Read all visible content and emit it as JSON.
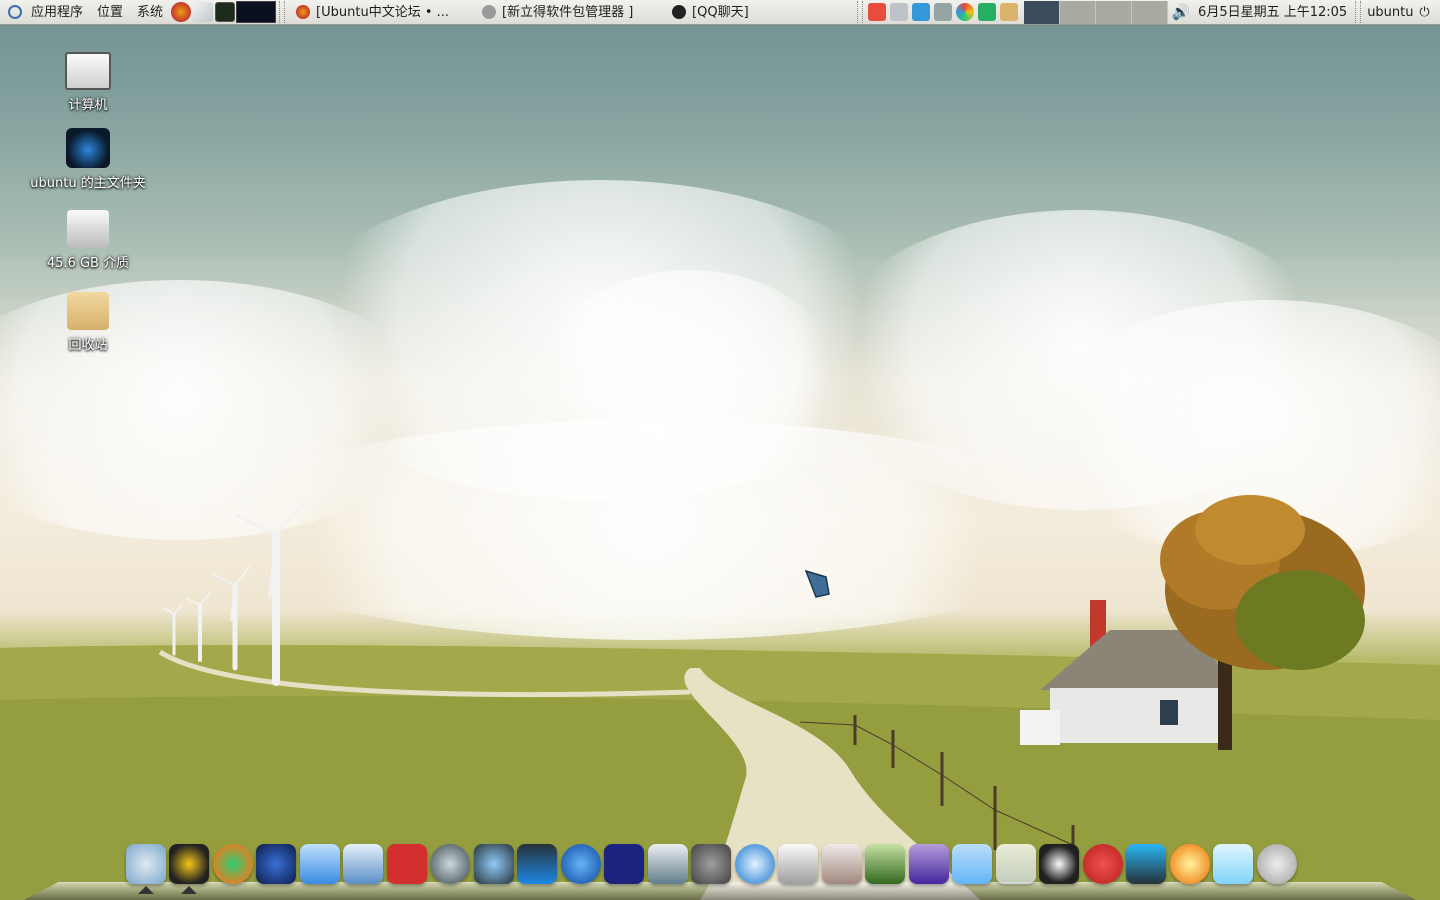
{
  "top_panel": {
    "menu": [
      "应用程序",
      "位置",
      "系统"
    ],
    "tasks": [
      "[Ubuntu中文论坛 • ...",
      "[新立得软件包管理器 ]",
      "[QQ聊天]"
    ],
    "clock": "6月5日星期五 上午12:05",
    "user": "ubuntu"
  },
  "desktop_icons": [
    "计算机",
    "ubuntu 的主文件夹",
    "45.6 GB 介质",
    "回收站"
  ],
  "colors": {
    "panel": "#dedcd6",
    "accent": "#3a6fb0"
  }
}
